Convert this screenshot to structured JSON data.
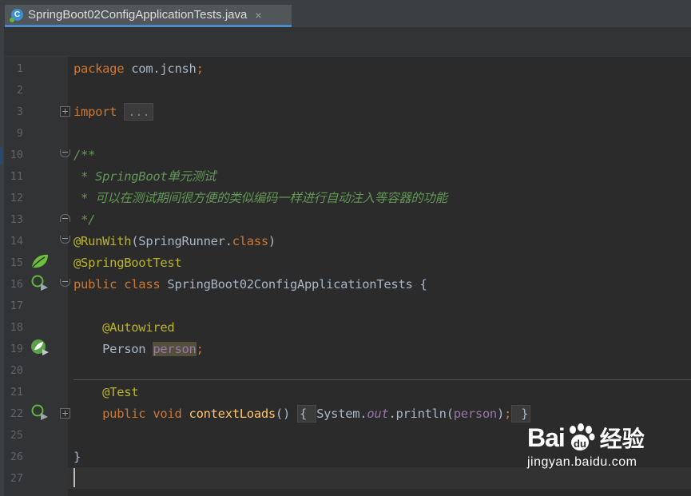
{
  "tab": {
    "title": "SpringBoot02ConfigApplicationTests.java",
    "close": "×",
    "icon": "java-class-icon"
  },
  "editor": {
    "lines": [
      {
        "num": "1",
        "segments": [
          {
            "t": "package ",
            "c": "kw"
          },
          {
            "t": "com.jcnsh",
            "c": "pl"
          },
          {
            "t": ";",
            "c": "kw"
          }
        ]
      },
      {
        "num": "2",
        "segments": []
      },
      {
        "num": "3",
        "segments": [
          {
            "t": "import ",
            "c": "kw"
          },
          {
            "t": "...",
            "c": "fold"
          }
        ]
      },
      {
        "num": "9",
        "segments": []
      },
      {
        "num": "10",
        "segments": [
          {
            "t": "/**",
            "c": "cm"
          }
        ]
      },
      {
        "num": "11",
        "segments": [
          {
            "t": " * SpringBoot单元测试",
            "c": "cm"
          }
        ]
      },
      {
        "num": "12",
        "segments": [
          {
            "t": " * 可以在测试期间很方便的类似编码一样进行自动注入等容器的功能",
            "c": "cm"
          }
        ]
      },
      {
        "num": "13",
        "segments": [
          {
            "t": " */",
            "c": "cm"
          }
        ]
      },
      {
        "num": "14",
        "segments": [
          {
            "t": "@RunWith",
            "c": "ann"
          },
          {
            "t": "(SpringRunner.",
            "c": "pl"
          },
          {
            "t": "class",
            "c": "kw"
          },
          {
            "t": ")",
            "c": "pl"
          }
        ]
      },
      {
        "num": "15",
        "segments": [
          {
            "t": "@SpringBootTest",
            "c": "ann"
          }
        ]
      },
      {
        "num": "16",
        "segments": [
          {
            "t": "public class ",
            "c": "kw"
          },
          {
            "t": "SpringBoot02ConfigApplicationTests {",
            "c": "pl"
          }
        ]
      },
      {
        "num": "17",
        "segments": []
      },
      {
        "num": "18",
        "segments": [
          {
            "t": "    ",
            "c": "pl"
          },
          {
            "t": "@Autowired",
            "c": "ann"
          }
        ]
      },
      {
        "num": "19",
        "segments": [
          {
            "t": "    Person ",
            "c": "pl"
          },
          {
            "t": "person",
            "c": "hl"
          },
          {
            "t": ";",
            "c": "kw"
          }
        ]
      },
      {
        "num": "20",
        "segments": []
      },
      {
        "num": "21",
        "segments": [
          {
            "t": "    ",
            "c": "pl"
          },
          {
            "t": "@Test",
            "c": "ann"
          }
        ]
      },
      {
        "num": "22",
        "segments": [
          {
            "t": "    ",
            "c": "pl"
          },
          {
            "t": "public void ",
            "c": "kw"
          },
          {
            "t": "contextLoads",
            "c": "mth"
          },
          {
            "t": "() ",
            "c": "pl"
          },
          {
            "t": "{ ",
            "c": "foldb"
          },
          {
            "t": "System.",
            "c": "pl"
          },
          {
            "t": "out",
            "c": "st"
          },
          {
            "t": ".println(",
            "c": "pl"
          },
          {
            "t": "person",
            "c": "fld"
          },
          {
            "t": ")",
            "c": "pl"
          },
          {
            "t": ";",
            "c": "kw"
          },
          {
            "t": " }",
            "c": "foldb"
          }
        ]
      },
      {
        "num": "25",
        "segments": []
      },
      {
        "num": "26",
        "segments": [
          {
            "t": "}",
            "c": "pl"
          }
        ]
      },
      {
        "num": "27",
        "segments": []
      }
    ]
  },
  "gutter_icons": [
    {
      "line": "15",
      "name": "spring-leaf-icon"
    },
    {
      "line": "16",
      "name": "run-test-icon"
    },
    {
      "line": "19",
      "name": "autowired-bean-icon"
    },
    {
      "line": "22",
      "name": "run-test-icon"
    }
  ],
  "colors": {
    "background": "#2b2b2b",
    "keyword": "#cc7832",
    "annotation": "#bbb529",
    "comment": "#629755",
    "field": "#9876aa",
    "plain": "#a9b7c6",
    "method": "#ffc66d",
    "spring_green": "#6bbf3a"
  },
  "watermark": {
    "brand_left": "Bai",
    "brand_right": "du",
    "suffix": "经验",
    "url": "jingyan.baidu.com"
  }
}
